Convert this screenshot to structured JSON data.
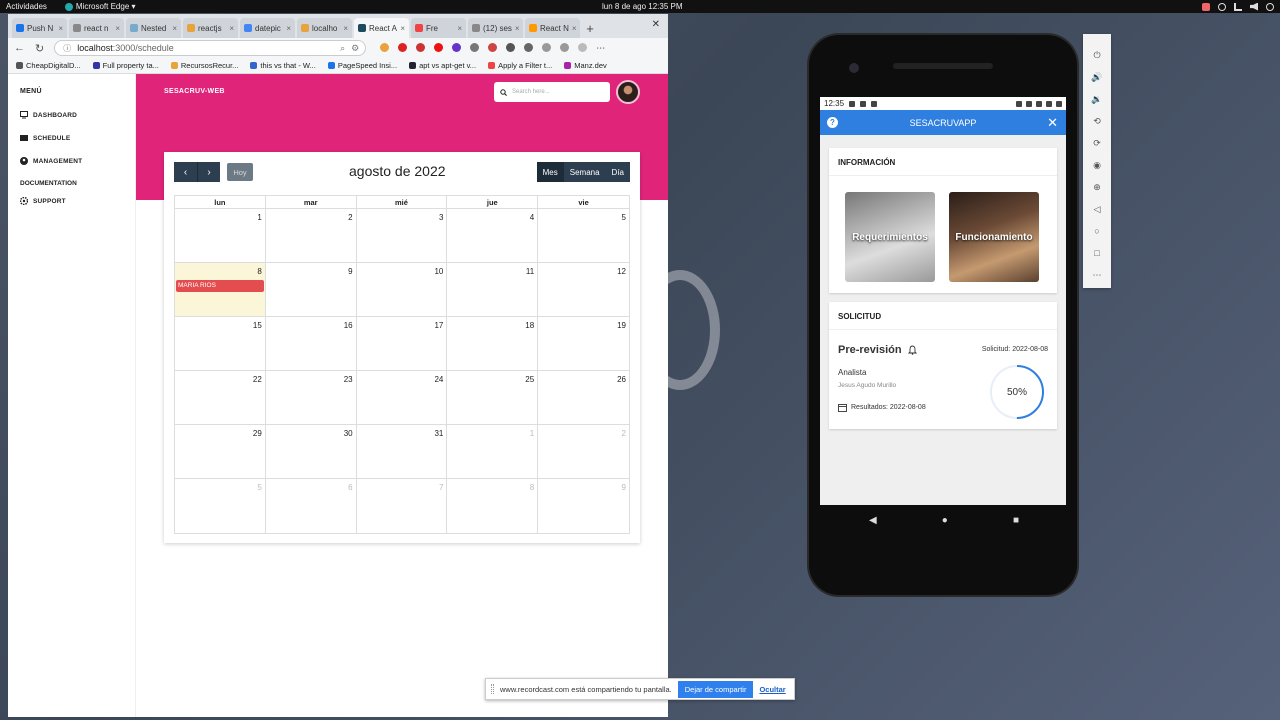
{
  "desktop": {
    "activities": "Actividades",
    "app_name": "Microsoft Edge ▾",
    "clock": "lun 8 de ago  12:35 PM"
  },
  "browser": {
    "tabs": [
      {
        "label": "Push N",
        "color": "#1a73e8"
      },
      {
        "label": "react n",
        "color": "#888"
      },
      {
        "label": "Nested",
        "color": "#7ac"
      },
      {
        "label": "reactjs",
        "color": "#e8a33c"
      },
      {
        "label": "datepic",
        "color": "#4285f4"
      },
      {
        "label": "localho",
        "color": "#e8a33c"
      },
      {
        "label": "React A",
        "color": "#1d4b5e",
        "active": true
      },
      {
        "label": "Fre",
        "color": "#e44"
      },
      {
        "label": "(12) ses",
        "color": "#888"
      },
      {
        "label": "React N",
        "color": "#f90"
      }
    ],
    "url_host": "localhost",
    "url_path": ":3000/schedule",
    "bookmarks": [
      {
        "label": "CheapDigitalD...",
        "color": "#555"
      },
      {
        "label": "Full property ta...",
        "color": "#33a"
      },
      {
        "label": "RecursosRecur...",
        "color": "#e8a33c"
      },
      {
        "label": "this vs that - W...",
        "color": "#3366cc"
      },
      {
        "label": "PageSpeed Insi...",
        "color": "#1a73e8"
      },
      {
        "label": "apt vs apt-get v...",
        "color": "#223"
      },
      {
        "label": "Apply a Filter t...",
        "color": "#e44"
      },
      {
        "label": "Manz.dev",
        "color": "#a2a"
      }
    ]
  },
  "sidebar": {
    "menu_title": "MENÚ",
    "items": [
      {
        "label": "DASHBOARD",
        "icon": "monitor-icon"
      },
      {
        "label": "SCHEDULE",
        "icon": "card-icon"
      },
      {
        "label": "MANAGEMENT",
        "icon": "user-circle-icon"
      }
    ],
    "docs_title": "DOCUMENTATION",
    "support": "SUPPORT"
  },
  "header": {
    "brand": "SESACRUV-WEB",
    "search_placeholder": "Search here..."
  },
  "calendar": {
    "title": "agosto de 2022",
    "today": "Hoy",
    "views": [
      "Mes",
      "Semana",
      "Día"
    ],
    "active_view": "Mes",
    "weekdays": [
      "lun",
      "mar",
      "mié",
      "jue",
      "vie"
    ],
    "weeks": [
      [
        {
          "d": "1"
        },
        {
          "d": "2"
        },
        {
          "d": "3"
        },
        {
          "d": "4"
        },
        {
          "d": "5"
        }
      ],
      [
        {
          "d": "8",
          "today": true,
          "event": "MARIA RIOS"
        },
        {
          "d": "9"
        },
        {
          "d": "10"
        },
        {
          "d": "11"
        },
        {
          "d": "12"
        }
      ],
      [
        {
          "d": "15"
        },
        {
          "d": "16"
        },
        {
          "d": "17"
        },
        {
          "d": "18"
        },
        {
          "d": "19"
        }
      ],
      [
        {
          "d": "22"
        },
        {
          "d": "23"
        },
        {
          "d": "24"
        },
        {
          "d": "25"
        },
        {
          "d": "26"
        }
      ],
      [
        {
          "d": "29"
        },
        {
          "d": "30"
        },
        {
          "d": "31"
        },
        {
          "d": "1",
          "muted": true
        },
        {
          "d": "2",
          "muted": true
        }
      ],
      [
        {
          "d": "5",
          "muted": true
        },
        {
          "d": "6",
          "muted": true
        },
        {
          "d": "7",
          "muted": true
        },
        {
          "d": "8",
          "muted": true
        },
        {
          "d": "9",
          "muted": true
        }
      ]
    ]
  },
  "share_bar": {
    "text": "www.recordcast.com está compartiendo tu pantalla.",
    "stop": "Dejar de compartir",
    "hide": "Ocultar"
  },
  "phone": {
    "time": "12:35",
    "app_title": "SESACRUVAPP",
    "info_title": "INFORMACIÓN",
    "tiles": [
      "Requerimientos",
      "Funcionamiento"
    ],
    "request_title": "SOLICITUD",
    "status": "Pre-revisión",
    "request_date": "Solicitud: 2022-08-08",
    "role": "Analista",
    "analyst_name": "Jesus Agudo Murillo",
    "results": "Resultados: 2022-08-08",
    "progress_label": "50%",
    "progress": 0.5,
    "accent": "#2f7fe0"
  },
  "emulator": {
    "controls": [
      "power-icon",
      "volume-up-icon",
      "volume-down-icon",
      "rotate-left-icon",
      "rotate-right-icon",
      "camera-icon",
      "zoom-icon",
      "back-icon",
      "home-icon",
      "overview-icon",
      "more-icon"
    ]
  }
}
